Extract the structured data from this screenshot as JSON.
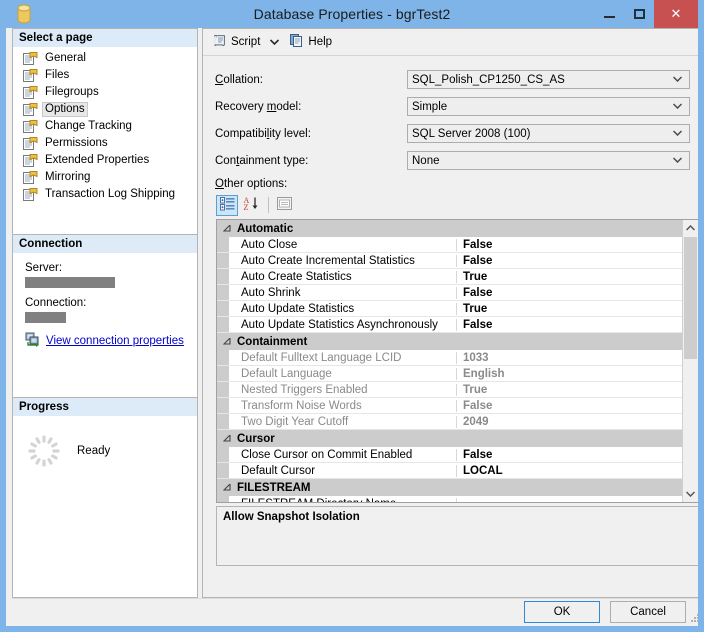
{
  "window": {
    "title": "Database Properties - bgrTest2",
    "icon": "database-cylinder-icon",
    "minimize_label": "Minimize",
    "maximize_label": "Maximize",
    "close_label": "Close"
  },
  "sidebar": {
    "header": "Select a page",
    "items": [
      {
        "label": "General",
        "selected": false
      },
      {
        "label": "Files",
        "selected": false
      },
      {
        "label": "Filegroups",
        "selected": false
      },
      {
        "label": "Options",
        "selected": true
      },
      {
        "label": "Change Tracking",
        "selected": false
      },
      {
        "label": "Permissions",
        "selected": false
      },
      {
        "label": "Extended Properties",
        "selected": false
      },
      {
        "label": "Mirroring",
        "selected": false
      },
      {
        "label": "Transaction Log Shipping",
        "selected": false
      }
    ],
    "connection": {
      "header": "Connection",
      "server_label": "Server:",
      "server_value": "",
      "connection_label": "Connection:",
      "connection_value": "",
      "link_label": "View connection properties",
      "link_icon": "server-connection-icon"
    },
    "progress": {
      "header": "Progress",
      "status": "Ready",
      "spinner_icon": "progress-spinner-icon"
    }
  },
  "toolbar": {
    "script_label": "Script",
    "script_icon": "script-scroll-icon",
    "dropdown_icon": "chevron-down-icon",
    "help_label": "Help",
    "help_icon": "help-pages-icon"
  },
  "form": {
    "fields": [
      {
        "label": "Collation:",
        "accel": "C",
        "value": "SQL_Polish_CP1250_CS_AS"
      },
      {
        "label": "Recovery model:",
        "accel": "m",
        "value": "Simple"
      },
      {
        "label": "Compatibility level:",
        "accel": "l",
        "value": "SQL Server 2008 (100)"
      },
      {
        "label": "Containment type:",
        "accel": "t",
        "value": "None"
      }
    ],
    "other_options_label": "Other options:"
  },
  "grid_toolbar": {
    "categorized_label": "Categorized",
    "categorized_icon": "categorized-view-icon",
    "alphabetical_label": "Alphabetical",
    "alphabetical_icon": "sort-alphabetical-icon",
    "property_pages_label": "Property Pages",
    "property_pages_icon": "property-pages-icon"
  },
  "property_grid": {
    "categories": [
      {
        "name": "Automatic",
        "disabled": false,
        "rows": [
          {
            "name": "Auto Close",
            "value": "False"
          },
          {
            "name": "Auto Create Incremental Statistics",
            "value": "False"
          },
          {
            "name": "Auto Create Statistics",
            "value": "True"
          },
          {
            "name": "Auto Shrink",
            "value": "False"
          },
          {
            "name": "Auto Update Statistics",
            "value": "True"
          },
          {
            "name": "Auto Update Statistics Asynchronously",
            "value": "False"
          }
        ]
      },
      {
        "name": "Containment",
        "disabled": true,
        "rows": [
          {
            "name": "Default Fulltext Language LCID",
            "value": "1033"
          },
          {
            "name": "Default Language",
            "value": "English"
          },
          {
            "name": "Nested Triggers Enabled",
            "value": "True"
          },
          {
            "name": "Transform Noise Words",
            "value": "False"
          },
          {
            "name": "Two Digit Year Cutoff",
            "value": "2049"
          }
        ]
      },
      {
        "name": "Cursor",
        "disabled": false,
        "rows": [
          {
            "name": "Close Cursor on Commit Enabled",
            "value": "False"
          },
          {
            "name": "Default Cursor",
            "value": "LOCAL"
          }
        ]
      },
      {
        "name": "FILESTREAM",
        "disabled": false,
        "rows": [
          {
            "name": "FILESTREAM Directory Name",
            "value": ""
          }
        ]
      }
    ],
    "scroll_up_icon": "chevron-up-icon",
    "scroll_down_icon": "chevron-down-icon"
  },
  "description": {
    "title": "Allow Snapshot Isolation"
  },
  "footer": {
    "ok_label": "OK",
    "cancel_label": "Cancel",
    "resize_grip": "resize-grip"
  },
  "colors": {
    "titlebar": "#7eb4e8",
    "close_button": "#c75050",
    "pane_header": "#dcebf7",
    "category_row": "#cccccc",
    "link": "#0000cc",
    "focus_border": "#2e8ad8"
  }
}
